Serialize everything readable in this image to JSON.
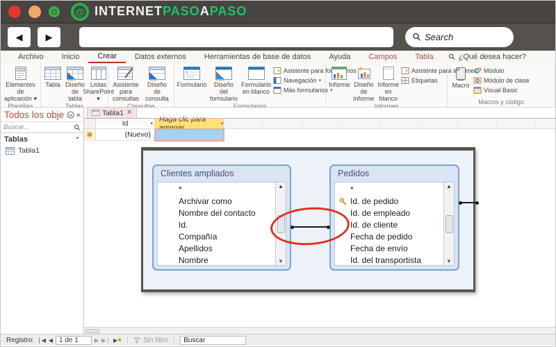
{
  "colors": {
    "accent_red": "#b5302d",
    "brand_green": "#1dc467",
    "highlight_yellow": "#ffe176",
    "selected_cell_blue": "#a6d1f0",
    "ellipse_red": "#e0301e",
    "diagram_box_blue": "#7fa1cb"
  },
  "titlebar": {
    "brand": {
      "p1": "INTERNET",
      "p2": "PASO",
      "p3": "A",
      "p4": "PASO"
    }
  },
  "navbar": {
    "search": "Search"
  },
  "menubar": {
    "items": [
      "Archivo",
      "Inicio",
      "Crear",
      "Datos externos",
      "Herramientas de base de datos",
      "Ayuda",
      "Campos",
      "Tabla"
    ],
    "help": "¿Qué desea hacer?"
  },
  "ribbon": {
    "groups": [
      "Plantillas",
      "Tablas",
      "Consultas",
      "Formularios",
      "Informes",
      "Macros y código"
    ],
    "buttons": {
      "app_parts": "Elementos de aplicación ▾",
      "table": "Tabla",
      "table_design": "Diseño de tabla",
      "sharepoint": "Listas SharePoint ▾",
      "query_wizard": "Asistente para consultas",
      "query_design": "Diseño de consulta",
      "form": "Formulario",
      "form_design": "Diseño del formulario",
      "blank_form": "Formulario en blanco",
      "form_wizard": "Asistente para formularios",
      "navigation": "Navegación",
      "more_forms": "Más formularios",
      "report": "Informe",
      "report_design": "Diseño de informe",
      "blank_report": "Informe en blanco",
      "report_wizard": "Asistente para informes",
      "labels": "Etiquetas",
      "macro": "Macro",
      "module": "Módulo",
      "class_module": "Módulo de clase",
      "visual_basic": "Visual Basic"
    }
  },
  "sidebar": {
    "title": "Todos los objet...",
    "search": "Buscar...",
    "group": "Tablas",
    "item1": "Tabla1"
  },
  "doc_tab": "Tabla1",
  "datasheet": {
    "col_id": "Id",
    "col_add": "Haga clic para agregar",
    "new_row": "(Nuevo)"
  },
  "diagram": {
    "left": {
      "title": "Clientes ampliados",
      "fields": [
        "*",
        "Archivar como",
        "Nombre del contacto",
        "Id.",
        "Compañía",
        "Apellidos",
        "Nombre"
      ]
    },
    "right": {
      "title": "Pedidos",
      "fields": [
        "*",
        "Id. de pedido",
        "Id. de empleado",
        "Id. de cliente",
        "Fecha de pedido",
        "Fecha de envío",
        "Id. del transportista"
      ]
    }
  },
  "statusbar": {
    "record": "Registro:",
    "position": "1 de 1",
    "filter": "Sin filtro",
    "search": "Buscar"
  }
}
